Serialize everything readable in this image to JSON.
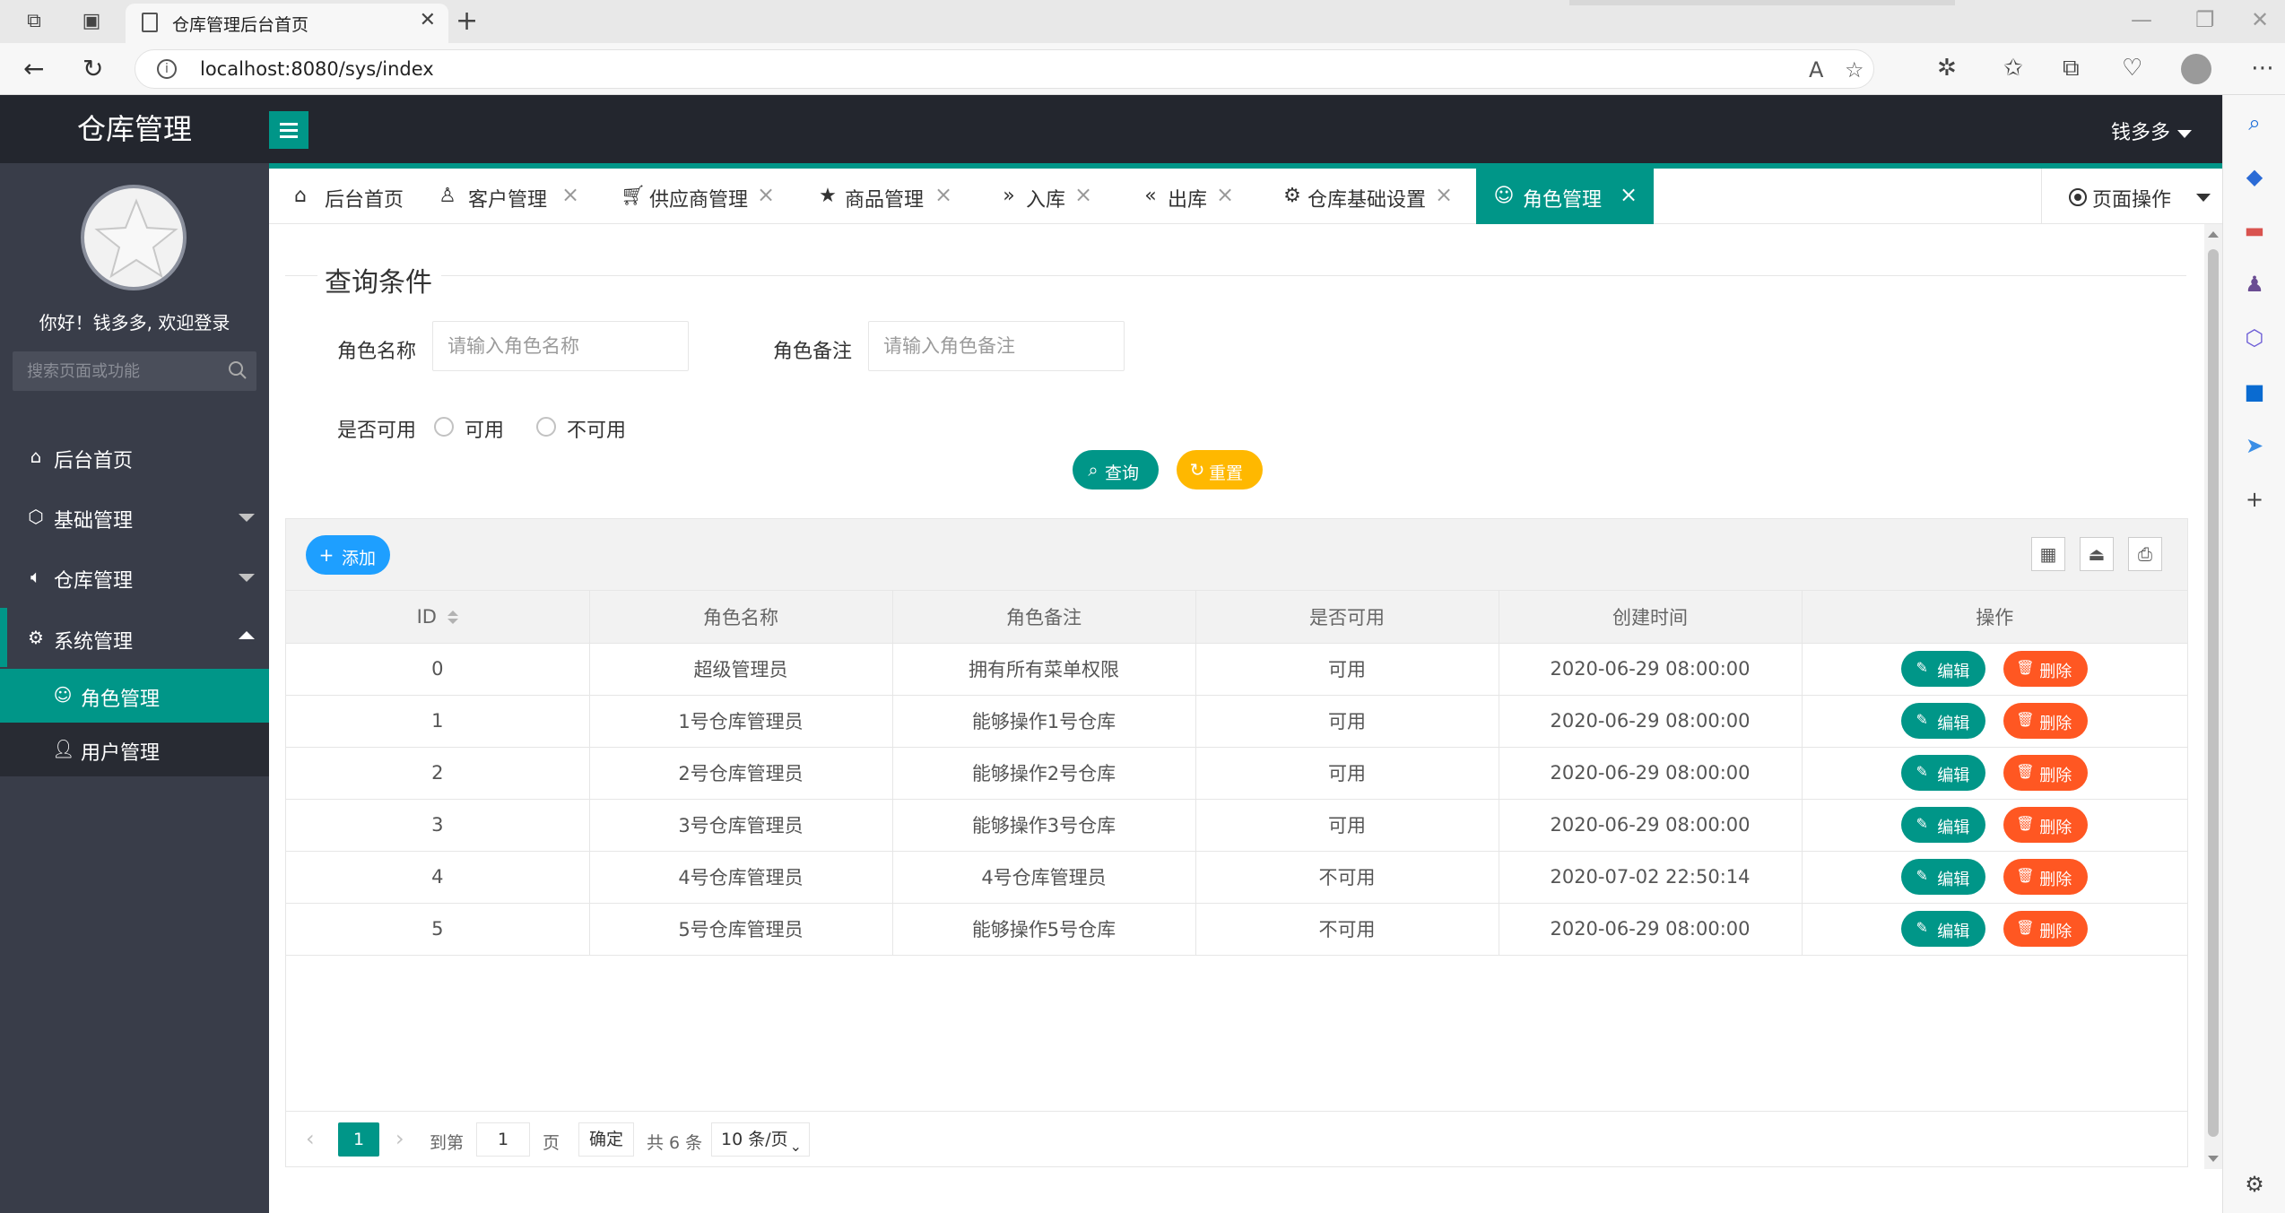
{
  "browser": {
    "tab_title": "仓库管理后台首页",
    "url": "localhost:8080/sys/index"
  },
  "app": {
    "logo": "仓库管理",
    "user_name": "钱多多",
    "welcome": "你好！钱多多, 欢迎登录",
    "search_placeholder": "搜索页面或功能"
  },
  "sidebar": {
    "items": [
      {
        "label": "后台首页",
        "icon": "home-icon"
      },
      {
        "label": "基础管理",
        "icon": "cube-icon"
      },
      {
        "label": "仓库管理",
        "icon": "speaker-icon"
      },
      {
        "label": "系统管理",
        "icon": "gear-icon"
      }
    ],
    "sub_items": [
      {
        "label": "角色管理",
        "icon": "smile-icon",
        "active": true
      },
      {
        "label": "用户管理",
        "icon": "user-icon",
        "active": false
      }
    ]
  },
  "page_tabs": [
    {
      "label": "后台首页",
      "icon": "home-icon"
    },
    {
      "label": "客户管理",
      "icon": "user-outline-icon"
    },
    {
      "label": "供应商管理",
      "icon": "cart-icon"
    },
    {
      "label": "商品管理",
      "icon": "star-icon"
    },
    {
      "label": "入库",
      "icon": "double-right-icon"
    },
    {
      "label": "出库",
      "icon": "double-left-icon"
    },
    {
      "label": "仓库基础设置",
      "icon": "gear-icon"
    },
    {
      "label": "角色管理",
      "icon": "smile-icon",
      "active": true
    }
  ],
  "page_ops_label": "页面操作",
  "query": {
    "legend": "查询条件",
    "role_name_label": "角色名称",
    "role_name_placeholder": "请输入角色名称",
    "role_remark_label": "角色备注",
    "role_remark_placeholder": "请输入角色备注",
    "available_label": "是否可用",
    "opt_yes": "可用",
    "opt_no": "不可用",
    "search_btn": "查询",
    "reset_btn": "重置"
  },
  "table": {
    "add_btn": "添加",
    "columns": [
      "ID",
      "角色名称",
      "角色备注",
      "是否可用",
      "创建时间",
      "操作"
    ],
    "rows": [
      {
        "id": "0",
        "name": "超级管理员",
        "remark": "拥有所有菜单权限",
        "status": "可用",
        "created": "2020-06-29 08:00:00"
      },
      {
        "id": "1",
        "name": "1号仓库管理员",
        "remark": "能够操作1号仓库",
        "status": "可用",
        "created": "2020-06-29 08:00:00"
      },
      {
        "id": "2",
        "name": "2号仓库管理员",
        "remark": "能够操作2号仓库",
        "status": "可用",
        "created": "2020-06-29 08:00:00"
      },
      {
        "id": "3",
        "name": "3号仓库管理员",
        "remark": "能够操作3号仓库",
        "status": "可用",
        "created": "2020-06-29 08:00:00"
      },
      {
        "id": "4",
        "name": "4号仓库管理员",
        "remark": "4号仓库管理员",
        "status": "不可用",
        "created": "2020-07-02 22:50:14"
      },
      {
        "id": "5",
        "name": "5号仓库管理员",
        "remark": "能够操作5号仓库",
        "status": "不可用",
        "created": "2020-06-29 08:00:00"
      }
    ],
    "edit_label": "编辑",
    "delete_label": "删除"
  },
  "pager": {
    "current": "1",
    "goto_label": "到第",
    "goto_value": "1",
    "page_unit": "页",
    "confirm": "确定",
    "total": "共 6 条",
    "per_page": "10 条/页"
  },
  "colors": {
    "accent": "#009688",
    "danger": "#ff5722",
    "warn": "#ffb800",
    "info": "#1e9fff",
    "sidebar": "#393d49",
    "header": "#23262e"
  }
}
